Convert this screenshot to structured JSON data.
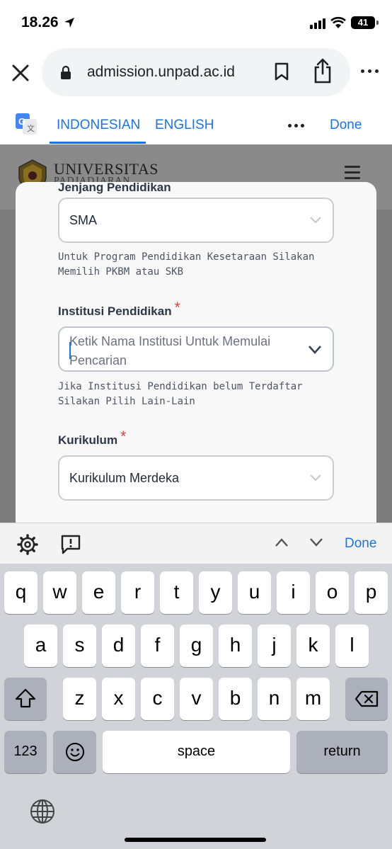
{
  "status_bar": {
    "time": "18.26",
    "battery": "41"
  },
  "browser": {
    "url": "admission.unpad.ac.id"
  },
  "translate_bar": {
    "tab_source": "INDONESIAN",
    "tab_target": "ENGLISH",
    "done": "Done"
  },
  "site": {
    "logo_text": "UNIVERSITAS",
    "logo_subtext": "PADJADJARAN"
  },
  "form": {
    "jenjang": {
      "label": "Jenjang Pendidikan",
      "value": "SMA",
      "help": "Untuk Program Pendidikan Kesetaraan Silakan Memilih PKBM atau SKB"
    },
    "institusi": {
      "label": "Institusi Pendidikan",
      "required": "*",
      "placeholder": "Ketik Nama Institusi Untuk Memulai Pencarian",
      "help": "Jika Institusi Pendidikan belum Terdaftar Silakan Pilih Lain-Lain"
    },
    "kurikulum": {
      "label": "Kurikulum",
      "required": "*",
      "value": "Kurikulum Merdeka"
    }
  },
  "accessory_bar": {
    "done": "Done"
  },
  "keyboard": {
    "row1": [
      "q",
      "w",
      "e",
      "r",
      "t",
      "y",
      "u",
      "i",
      "o",
      "p"
    ],
    "row2": [
      "a",
      "s",
      "d",
      "f",
      "g",
      "h",
      "j",
      "k",
      "l"
    ],
    "row3": [
      "z",
      "x",
      "c",
      "v",
      "b",
      "n",
      "m"
    ],
    "numbers_key": "123",
    "space_key": "space",
    "return_key": "return"
  },
  "colors": {
    "accent": "#1a73e8",
    "required": "#e53e3e"
  }
}
